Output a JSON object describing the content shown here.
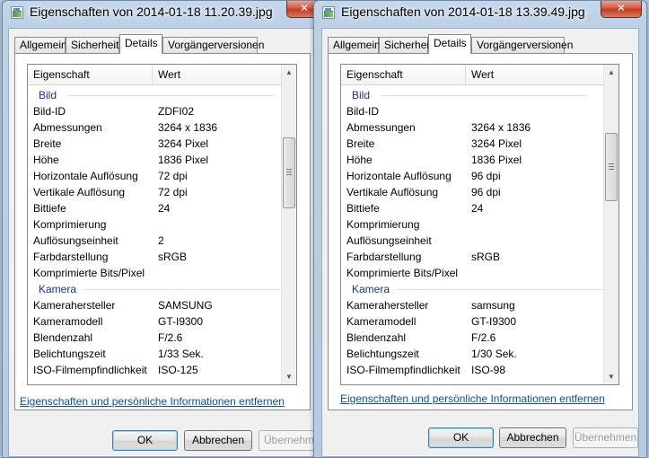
{
  "left": {
    "title": "Eigenschaften von 2014-01-18 11.20.39.jpg",
    "tabs": [
      "Allgemein",
      "Sicherheit",
      "Details",
      "Vorgängerversionen"
    ],
    "active_tab": "Details",
    "columns": [
      "Eigenschaft",
      "Wert"
    ],
    "groups": [
      {
        "name": "Bild",
        "rows": [
          {
            "key": "Bild-ID",
            "value": "ZDFI02"
          },
          {
            "key": "Abmessungen",
            "value": "3264 x 1836"
          },
          {
            "key": "Breite",
            "value": "3264 Pixel"
          },
          {
            "key": "Höhe",
            "value": "1836 Pixel"
          },
          {
            "key": "Horizontale Auflösung",
            "value": "72 dpi"
          },
          {
            "key": "Vertikale Auflösung",
            "value": "72 dpi"
          },
          {
            "key": "Bittiefe",
            "value": "24"
          },
          {
            "key": "Komprimierung",
            "value": ""
          },
          {
            "key": "Auflösungseinheit",
            "value": "2"
          },
          {
            "key": "Farbdarstellung",
            "value": "sRGB"
          },
          {
            "key": "Komprimierte Bits/Pixel",
            "value": ""
          }
        ]
      },
      {
        "name": "Kamera",
        "rows": [
          {
            "key": "Kamerahersteller",
            "value": "SAMSUNG"
          },
          {
            "key": "Kameramodell",
            "value": "GT-I9300"
          },
          {
            "key": "Blendenzahl",
            "value": "F/2.6"
          },
          {
            "key": "Belichtungszeit",
            "value": "1/33 Sek."
          },
          {
            "key": "ISO-Filmempfindlichkeit",
            "value": "ISO-125"
          }
        ]
      }
    ],
    "remove_link": "Eigenschaften und persönliche Informationen entfernen",
    "buttons": {
      "ok": "OK",
      "cancel": "Abbrechen",
      "apply": "Übernehmen"
    }
  },
  "right": {
    "title": "Eigenschaften von 2014-01-18 13.39.49.jpg",
    "tabs": [
      "Allgemein",
      "Sicherheit",
      "Details",
      "Vorgängerversionen"
    ],
    "active_tab": "Details",
    "columns": [
      "Eigenschaft",
      "Wert"
    ],
    "groups": [
      {
        "name": "Bild",
        "rows": [
          {
            "key": "Bild-ID",
            "value": ""
          },
          {
            "key": "Abmessungen",
            "value": "3264 x 1836"
          },
          {
            "key": "Breite",
            "value": "3264 Pixel"
          },
          {
            "key": "Höhe",
            "value": "1836 Pixel"
          },
          {
            "key": "Horizontale Auflösung",
            "value": "96 dpi"
          },
          {
            "key": "Vertikale Auflösung",
            "value": "96 dpi"
          },
          {
            "key": "Bittiefe",
            "value": "24"
          },
          {
            "key": "Komprimierung",
            "value": ""
          },
          {
            "key": "Auflösungseinheit",
            "value": ""
          },
          {
            "key": "Farbdarstellung",
            "value": "sRGB"
          },
          {
            "key": "Komprimierte Bits/Pixel",
            "value": ""
          }
        ]
      },
      {
        "name": "Kamera",
        "rows": [
          {
            "key": "Kamerahersteller",
            "value": "samsung"
          },
          {
            "key": "Kameramodell",
            "value": "GT-I9300"
          },
          {
            "key": "Blendenzahl",
            "value": "F/2.6"
          },
          {
            "key": "Belichtungszeit",
            "value": "1/30 Sek."
          },
          {
            "key": "ISO-Filmempfindlichkeit",
            "value": "ISO-98"
          }
        ]
      }
    ],
    "remove_link": "Eigenschaften und persönliche Informationen entfernen",
    "buttons": {
      "ok": "OK",
      "cancel": "Abbrechen",
      "apply": "Übernehmen"
    }
  },
  "icons": {
    "close": "close-icon",
    "file": "jpg-file-icon"
  },
  "colors": {
    "group_header": "#1e3287",
    "link": "#0c4fa7",
    "close_button": "#c8442c"
  }
}
